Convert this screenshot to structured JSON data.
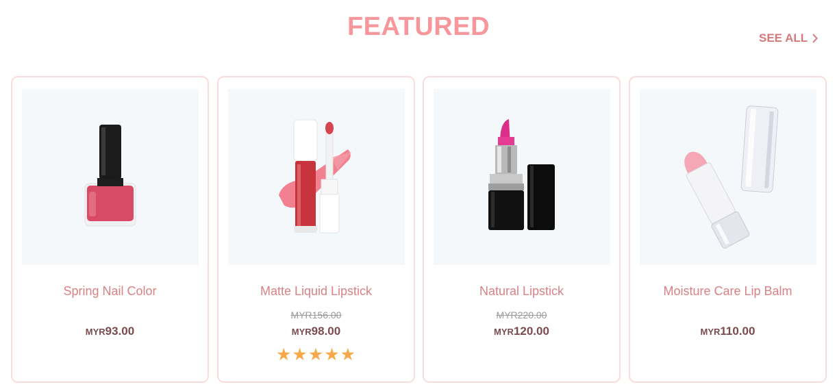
{
  "section": {
    "title": "FEATURED",
    "see_all_label": "SEE ALL",
    "see_all_icon": "chevron-right-icon"
  },
  "colors": {
    "title": "#f7969b",
    "accent": "#d5797d",
    "price": "#7a4a4c",
    "card_border": "#fbdcdc",
    "star": "#f7a94a"
  },
  "products": [
    {
      "name": "Spring Nail Color",
      "image": "nail-polish-image",
      "old_price": "",
      "currency": "MYR",
      "price": "93.00",
      "rating": null
    },
    {
      "name": "Matte Liquid Lipstick",
      "image": "liquid-lipstick-image",
      "old_price": "MYR156.00",
      "currency": "MYR",
      "price": "98.00",
      "rating": 5,
      "stars": "★★★★★"
    },
    {
      "name": "Natural Lipstick",
      "image": "lipstick-image",
      "old_price": "MYR220.00",
      "currency": "MYR",
      "price": "120.00",
      "rating": null
    },
    {
      "name": "Moisture Care Lip Balm",
      "image": "lip-balm-image",
      "old_price": "",
      "currency": "MYR",
      "price": "110.00",
      "rating": null
    }
  ]
}
